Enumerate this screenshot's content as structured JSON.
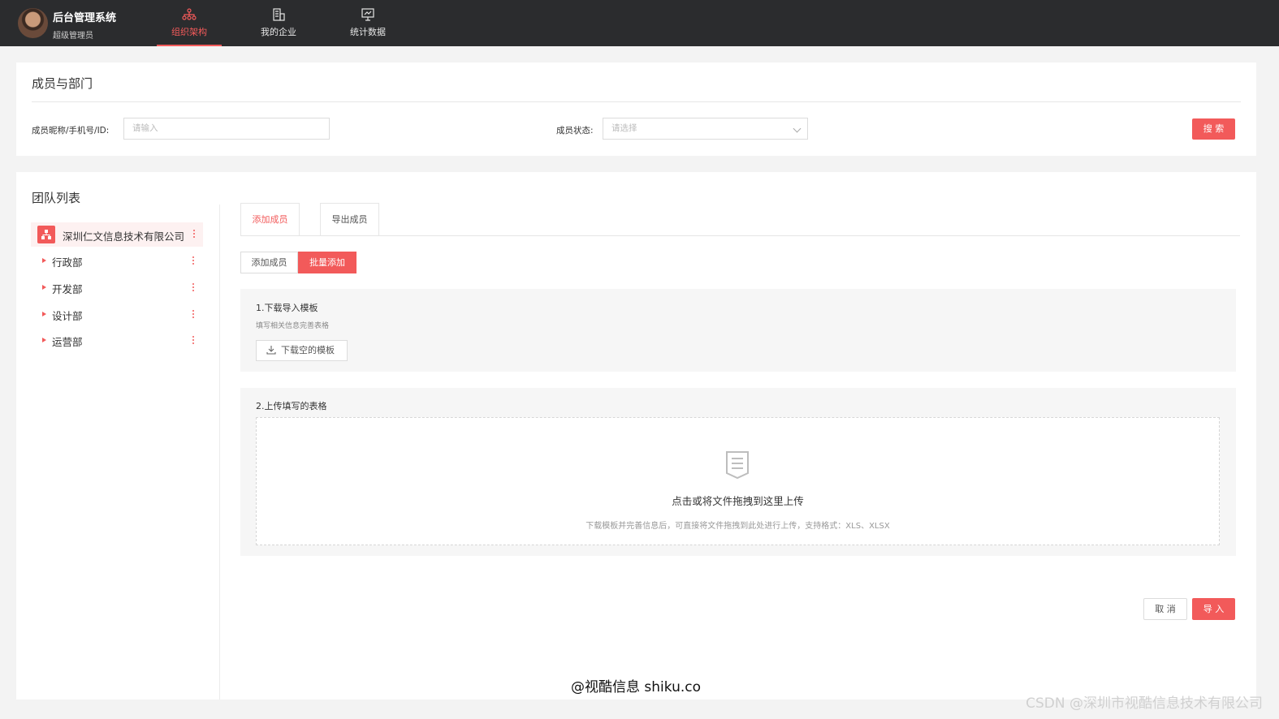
{
  "app": {
    "title": "后台管理系统",
    "role": "超级管理员"
  },
  "nav": [
    {
      "label": "组织架构",
      "icon": "org-chart-icon",
      "active": true
    },
    {
      "label": "我的企业",
      "icon": "building-icon",
      "active": false
    },
    {
      "label": "统计数据",
      "icon": "presentation-chart-icon",
      "active": false
    }
  ],
  "search": {
    "title": "成员与部门",
    "member_label": "成员昵称/手机号/ID:",
    "member_placeholder": "请输入",
    "status_label": "成员状态:",
    "status_placeholder": "请选择",
    "search_button": "搜 索"
  },
  "team": {
    "title": "团队列表",
    "root": "深圳仁文信息技术有限公司",
    "departments": [
      "行政部",
      "开发部",
      "设计部",
      "运营部"
    ]
  },
  "tabs": [
    {
      "label": "添加成员",
      "active": true
    },
    {
      "label": "导出成员",
      "active": false
    }
  ],
  "modes": [
    {
      "label": "添加成员",
      "active": false
    },
    {
      "label": "批量添加",
      "active": true
    }
  ],
  "step1": {
    "title": "1.下载导入模板",
    "subtitle": "填写相关信息完善表格",
    "button": "下载空的模板"
  },
  "step2": {
    "title": "2.上传填写的表格",
    "drop_title": "点击或将文件拖拽到这里上传",
    "drop_hint": "下载模板并完善信息后，可直接将文件拖拽到此处进行上传，支持格式：XLS、XLSX"
  },
  "actions": {
    "cancel": "取 消",
    "import": "导 入"
  },
  "watermarks": {
    "center": "@视酷信息 shiku.co",
    "corner": "CSDN @深圳市视酷信息技术有限公司"
  },
  "colors": {
    "accent": "#f25a5a",
    "topbar": "#2b2c2e"
  }
}
